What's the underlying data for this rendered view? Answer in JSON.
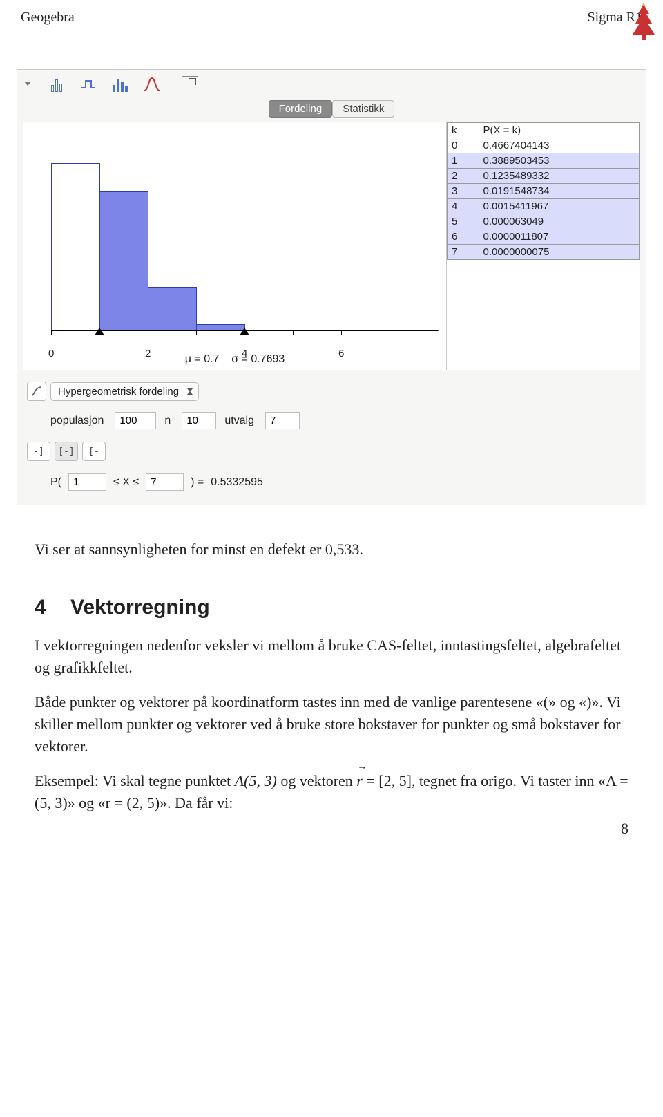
{
  "header": {
    "left": "Geogebra",
    "right": "Sigma R1"
  },
  "tabs": {
    "active": "Fordeling",
    "other": "Statistikk"
  },
  "chart_data": {
    "type": "bar",
    "categories": [
      0,
      1,
      2,
      3,
      4,
      5,
      6,
      7
    ],
    "values": [
      0.4667404143,
      0.3889503453,
      0.1235489332,
      0.0191548734,
      0.0015411967,
      6.3049e-05,
      1.1807e-06,
      7.5e-09
    ],
    "highlight_range": [
      1,
      7
    ],
    "xticks": [
      0,
      2,
      4,
      6
    ],
    "markers_x": [
      1,
      4
    ],
    "mu_label": "μ = 0.7",
    "sigma_label": "σ = 0.7693",
    "ylim": [
      0,
      0.5
    ]
  },
  "ptable": {
    "headers": [
      "k",
      "P(X = k)"
    ],
    "rows": [
      {
        "k": "0",
        "p": "0.4667404143",
        "sel": false
      },
      {
        "k": "1",
        "p": "0.3889503453",
        "sel": true
      },
      {
        "k": "2",
        "p": "0.1235489332",
        "sel": true
      },
      {
        "k": "3",
        "p": "0.0191548734",
        "sel": true
      },
      {
        "k": "4",
        "p": "0.0015411967",
        "sel": true
      },
      {
        "k": "5",
        "p": "0.000063049",
        "sel": true
      },
      {
        "k": "6",
        "p": "0.0000011807",
        "sel": true
      },
      {
        "k": "7",
        "p": "0.0000000075",
        "sel": true
      }
    ]
  },
  "distribution": {
    "name": "Hypergeometrisk fordeling",
    "params": {
      "populasjon_label": "populasjon",
      "populasjon": "100",
      "n_label": "n",
      "n": "10",
      "utvalg_label": "utvalg",
      "utvalg": "7"
    }
  },
  "interval_toggles": {
    "left": "-]",
    "both": "[-]",
    "right": "[-"
  },
  "prob": {
    "prefix": "P(",
    "lower": "1",
    "mid": "≤ X ≤",
    "upper": "7",
    "close": ")  =",
    "value": "0.5332595"
  },
  "text": {
    "p1": "Vi ser at sannsynligheten for minst en defekt er 0,533.",
    "sec_num": "4",
    "sec_title": "Vektorregning",
    "p2": "I vektorregningen nedenfor veksler vi mellom å bruke CAS-feltet, inntastingsfeltet, algebrafeltet og grafikkfeltet.",
    "p3": "Både punkter og vektorer på koordinatform tastes inn med de vanlige parentesene «(» og «)». Vi skiller mellom punkter og vektorer ved å bruke store bokstaver for punkter og små bokstaver for vektorer.",
    "p4a": "Eksempel: Vi skal tegne punktet ",
    "p4b": "A(5, 3)",
    "p4c": " og vektoren ",
    "p4d": "r",
    "p4e": " = [2, 5], tegnet fra origo. Vi taster inn «A = (5, 3)» og «r = (2, 5)». Da får vi:"
  },
  "page_number": "8"
}
